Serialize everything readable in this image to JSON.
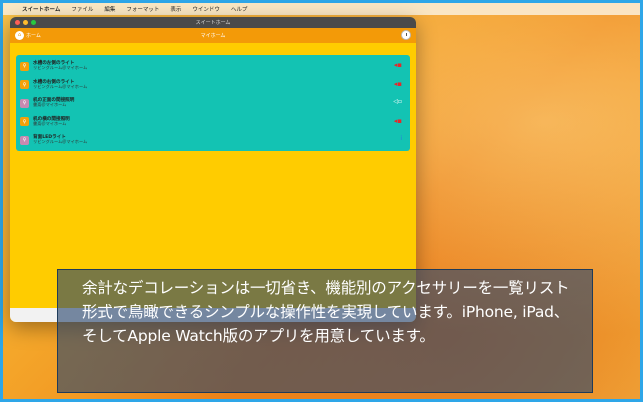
{
  "menubar": {
    "apple": "",
    "app_name": "スイートホーム",
    "items": [
      "ファイル",
      "編集",
      "フォーマット",
      "表示",
      "ウインドウ",
      "ヘルプ"
    ]
  },
  "window": {
    "title": "スイートホーム",
    "nav": {
      "home_label": "ホーム",
      "title": "マイホーム"
    },
    "devices": [
      {
        "name": "水槽の左側のライト",
        "room": "リビングルーム＠マイホーム",
        "icon": "lightbulb-icon",
        "icon_state": "on",
        "status": "power-on-indicator",
        "status_color": "#e8262a"
      },
      {
        "name": "水槽の右側のライト",
        "room": "リビングルーム＠マイホーム",
        "icon": "lightbulb-icon",
        "icon_state": "on",
        "status": "power-on-indicator",
        "status_color": "#e8262a"
      },
      {
        "name": "机の正面の間接照明",
        "room": "書斎＠マイホーム",
        "icon": "lightbulb-icon",
        "icon_state": "off",
        "status": "power-off-indicator",
        "status_color": "#ffffff"
      },
      {
        "name": "机の横の間接照明",
        "room": "書斎＠マイホーム",
        "icon": "lightbulb-icon",
        "icon_state": "on",
        "status": "power-on-indicator",
        "status_color": "#e8262a"
      },
      {
        "name": "背面LEDライト",
        "room": "リビングルーム＠マイホーム",
        "icon": "lightbulb-icon",
        "icon_state": "off",
        "status": "info-indicator",
        "status_color": "#2a7bde"
      }
    ]
  },
  "caption": {
    "text": "余計なデコレーションは一切省き、機能別のアクセサリーを一覧リスト形式で鳥瞰できるシンプルな操作性を実現しています。iPhone, iPad、そしてApple Watch版のアプリを用意しています。"
  },
  "colors": {
    "accent_orange": "#f39a08",
    "background_yellow": "#ffcc00",
    "list_teal": "#13c3b3"
  }
}
